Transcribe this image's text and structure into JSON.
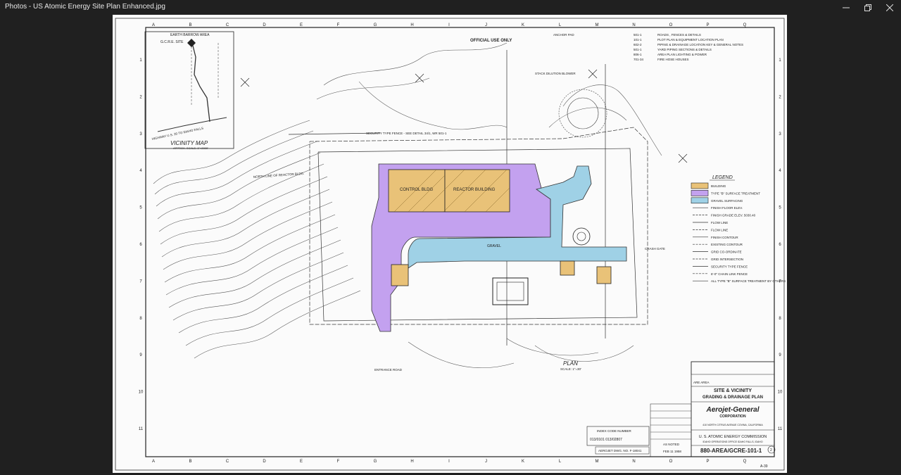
{
  "window": {
    "title": "Photos - US Atomic Energy Site Plan Enhanced.jpg"
  },
  "sheet": {
    "col_labels": [
      "A",
      "B",
      "C",
      "D",
      "E",
      "F",
      "G",
      "H",
      "I",
      "J",
      "K",
      "L",
      "M",
      "N",
      "O",
      "P",
      "Q"
    ],
    "row_labels": [
      "1",
      "2",
      "3",
      "4",
      "5",
      "6",
      "7",
      "8",
      "9",
      "10",
      "11"
    ],
    "stamp": "OFFICIAL USE ONLY",
    "vicinity": {
      "title": "VICINITY MAP",
      "scale": "APPROX. SCALE: 1\"=2000'",
      "top_label": "EARTH BARROW AREA",
      "site_label": "G.C.R.E. SITE",
      "highway": "HIGHWAY U.S. 20 TO IDAHO FALLS"
    },
    "notes": [
      {
        "code": "501-1",
        "text": "ROADS , FENCES & DETAILS"
      },
      {
        "code": "101-1",
        "text": "PLOT PLAN & EQUIPMENT LOCATION PLAN"
      },
      {
        "code": "602-2",
        "text": "PIPING & DRAINAGE LOCATION KEY & GENERAL NOTES"
      },
      {
        "code": "501-1",
        "text": "YARD PIPING SECTIONS & DETAILS"
      },
      {
        "code": "806-1",
        "text": "AREA PLAN LIGHTING & POWER"
      },
      {
        "code": "701-34",
        "text": "FIRE HOSE HOUSES"
      }
    ],
    "legend": {
      "title": "LEGEND",
      "items": [
        {
          "label": "BUILDING",
          "color": "#e9c278"
        },
        {
          "label": "TYPE \"B\" SURFACE TREATMENT",
          "color": "#c3a1ef"
        },
        {
          "label": "GRAVEL SURFACING",
          "color": "#9fd1e6"
        },
        {
          "label": "FINISH FLOOR ELEV.",
          "color": ""
        },
        {
          "label": "FINISH GRADE ELEV. 5030.40",
          "color": ""
        },
        {
          "label": "FLOW LINE",
          "color": ""
        },
        {
          "label": "FLOW LINE",
          "color": ""
        },
        {
          "label": "FINISH CONTOUR",
          "color": ""
        },
        {
          "label": "EXISTING CONTOUR",
          "color": ""
        },
        {
          "label": "GRID CO-ORDINATE",
          "color": ""
        },
        {
          "label": "GRID INTERSECTION",
          "color": ""
        },
        {
          "label": "SECURITY TYPE FENCE",
          "color": ""
        },
        {
          "label": "6'-0\" CHAIN LINK FENCE",
          "color": ""
        },
        {
          "label": "ALL TYPE \"B\" SURFACE TREATMENT BY OTHERS",
          "color": ""
        }
      ]
    },
    "labels": {
      "control_bldg": "CONTROL BLDG",
      "reactor_bldg": "REACTOR BUILDING",
      "plan": "PLAN",
      "plan_scale": "SCALE: 1\"=30'",
      "entrance_road": "ENTRANCE ROAD",
      "north_line": "NORTH LINE OF REACTOR BLDG.",
      "security_fence": "SECURITY TYPE FENCE - SEE DETAIL 34/1, WR 501-1",
      "crash_gate": "CRASH GATE",
      "anchor_pad": "ANCHOR PAD",
      "stack_blower": "STACK DILUTION BLOWER",
      "gravel": "GRAVEL"
    },
    "title_block": {
      "project": "SITE & VICINITY",
      "subtitle": "GRADING & DRAINAGE PLAN",
      "company": "Aerojet-General",
      "company_sub": "CORPORATION",
      "company_address": "410 NORTH CITRUS AVENUE  COVINA, CALIFORNIA",
      "agency": "U. S. ATOMIC ENERGY COMMISSION",
      "agency_sub": "IDAHO OPERATIONS OFFICE  IDAHO FALLS, IDAHO",
      "area": "ARE AREA",
      "dwg_no": "880-AREA/GCRE-101-1",
      "index_code": "INDEX CODE NUMBER",
      "index_number": "013/0101  013/02807",
      "aerojet_dwg": "AEROJET DWG. NO. F-18041",
      "date": "FEB 11 1958",
      "scale_note": "AS NOTED",
      "sheet_note": "2",
      "corner": "A-39"
    }
  },
  "colors": {
    "building": "#e9c278",
    "surface_b": "#c3a1ef",
    "gravel": "#9fd1e6",
    "ink": "#222222",
    "chrome": "#202020"
  }
}
